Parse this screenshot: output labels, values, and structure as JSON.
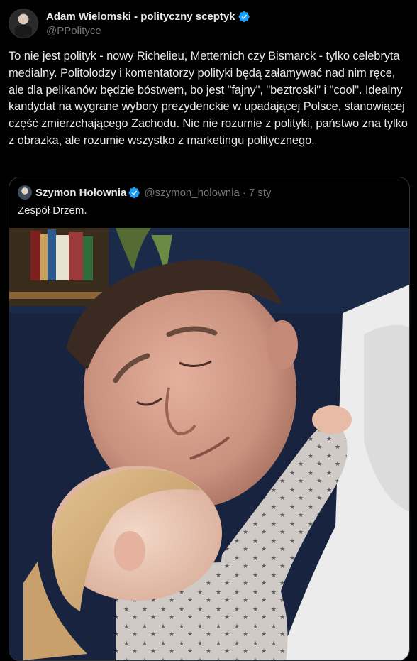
{
  "tweet": {
    "author_name": "Adam Wielomski - polityczny sceptyk",
    "author_handle": "@PPolityce",
    "text": "To nie jest polityk - nowy Richelieu, Metternich czy Bismarck - tylko celebryta medialny. Politolodzy i komentatorzy polityki będą załamywać nad nim ręce, ale dla pelikanów będzie bóstwem, bo jest \"fajny\", \"beztroski\" i \"cool\". Idealny kandydat na wygrane wybory prezydenckie w upadającej Polsce, stanowiącej część zmierzchającego Zachodu. Nic nie rozumie z polityki, państwo zna tylko z obrazka, ale rozumie wszystko z marketingu politycznego."
  },
  "quoted": {
    "author_name": "Szymon Hołownia",
    "author_handle": "@szymon_holownia",
    "separator": "·",
    "time": "7 sty",
    "text": "Zespół Drzem."
  },
  "icons": {
    "verified": "verified-badge-icon"
  },
  "colors": {
    "background": "#000000",
    "text": "#e7e9ea",
    "muted": "#71767b",
    "border": "#2f3336",
    "verified": "#1d9bf0"
  }
}
